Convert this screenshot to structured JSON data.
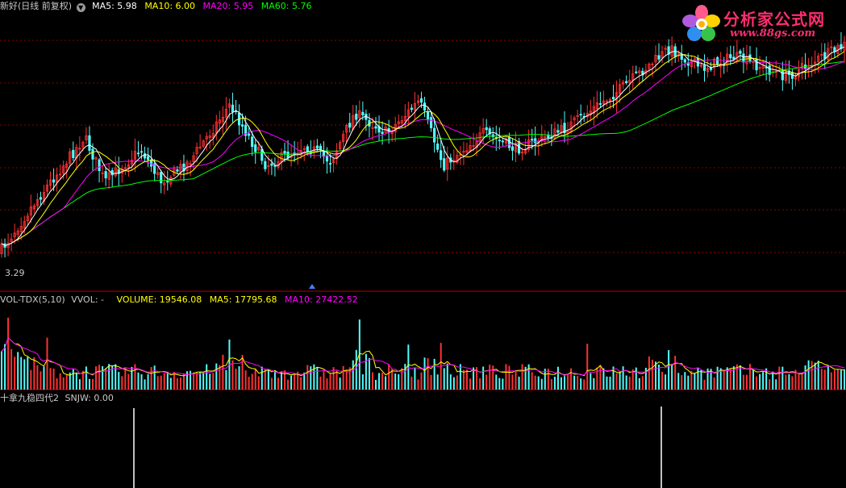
{
  "price_header": {
    "title": "新好(日线 前复权)",
    "ma5": "MA5: 5.98",
    "ma10": "MA10: 6.00",
    "ma20": "MA20: 5.95",
    "ma60": "MA60: 5.76"
  },
  "low_label": "3.29",
  "volume_header": {
    "name": "VOL-TDX(5,10)",
    "vvol": "VVOL: -",
    "volume": "VOLUME: 19546.08",
    "ma5": "MA5: 17795.68",
    "ma10": "MA10: 27422.52"
  },
  "indicator_header": {
    "name": "十拿九稳四代2",
    "snjw": "SNJW: 0.00"
  },
  "logo": {
    "name": "分析家公式网",
    "url": "www.88gs.com"
  },
  "colors": {
    "background": "#000000",
    "up": "#ff3232",
    "down": "#54fcfc",
    "ma5": "#ffffff",
    "ma10": "#ffff00",
    "ma20": "#ff00ff",
    "ma60": "#00ff00",
    "grid": "#8b0000",
    "divider": "#b00000",
    "logo": "#ff2d6e"
  },
  "icons": {
    "dropdown": "chevron-down-circle-icon",
    "marker": "triangle-up-icon",
    "logo": "flower-logo-icon"
  }
}
